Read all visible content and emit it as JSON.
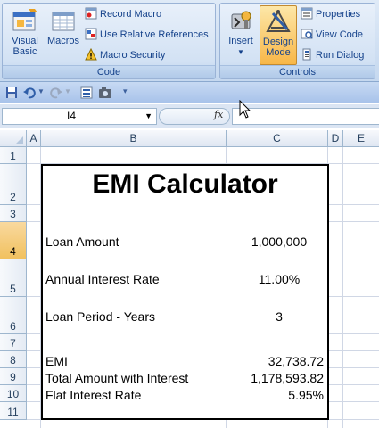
{
  "ribbon": {
    "code_group": {
      "label": "Code",
      "visual_basic": "Visual Basic",
      "visual_basic_line1": "Visual",
      "visual_basic_line2": "Basic",
      "macros": "Macros",
      "record_macro": "Record Macro",
      "use_relative_references": "Use Relative References",
      "macro_security": "Macro Security"
    },
    "controls_group": {
      "label": "Controls",
      "insert": "Insert",
      "design_mode_line1": "Design",
      "design_mode_line2": "Mode",
      "properties": "Properties",
      "view_code": "View Code",
      "run_dialog": "Run Dialog"
    }
  },
  "formula_bar": {
    "name_box": "I4",
    "fx": "fx",
    "formula": ""
  },
  "columns": [
    "A",
    "B",
    "C",
    "D",
    "E"
  ],
  "rows": [
    "1",
    "2",
    "3",
    "4",
    "5",
    "6",
    "7",
    "8",
    "9",
    "10",
    "11"
  ],
  "calculator": {
    "title": "EMI Calculator",
    "loan_amount_label": "Loan Amount",
    "loan_amount_value": "1,000,000",
    "interest_rate_label": "Annual Interest Rate",
    "interest_rate_value": "11.00%",
    "loan_period_label": "Loan Period - Years",
    "loan_period_value": "3",
    "emi_label": "EMI",
    "emi_value": "32,738.72",
    "total_label": "Total Amount with Interest",
    "total_value": "1,178,593.82",
    "flat_rate_label": "Flat Interest Rate",
    "flat_rate_value": "5.95%"
  },
  "colors": {
    "ribbon_text": "#15428b",
    "selected_row": "#f1c15f",
    "grid": "#d0d7e5"
  }
}
